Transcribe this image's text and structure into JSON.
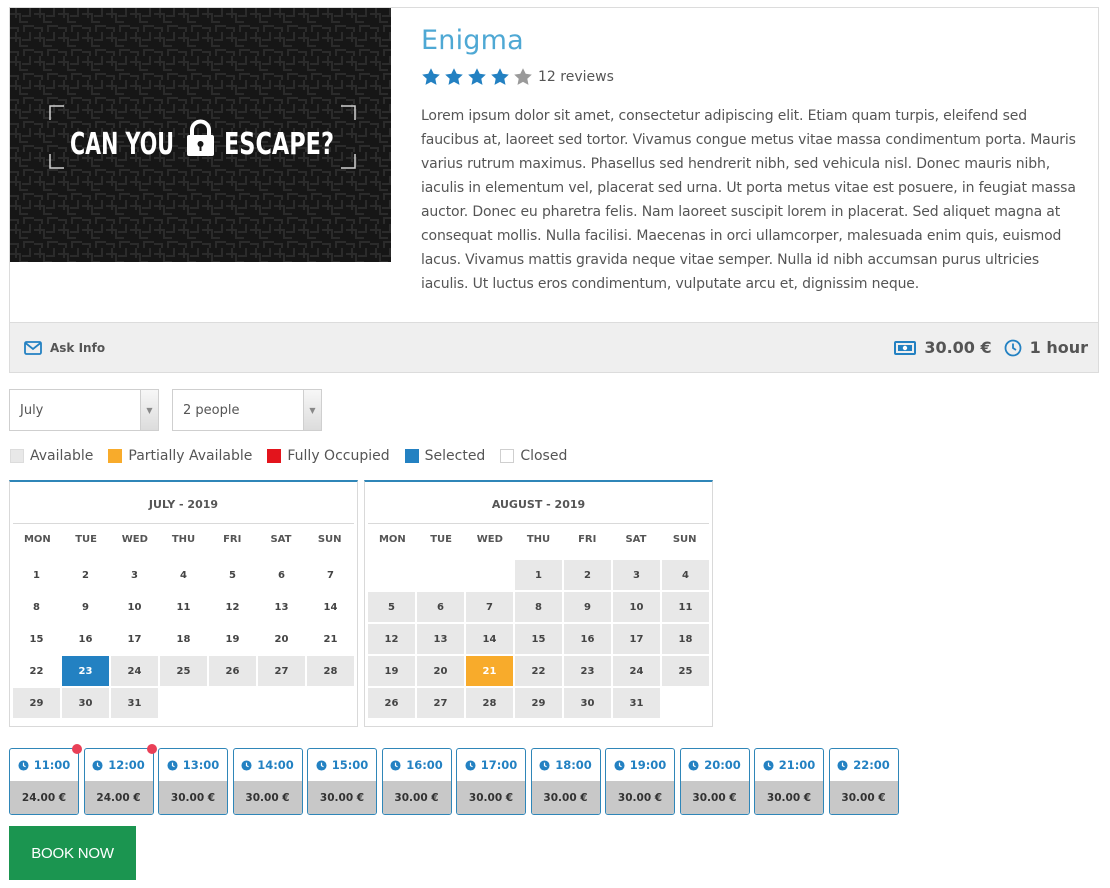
{
  "product": {
    "title": "Enigma",
    "rating": {
      "stars": 4,
      "max": 5,
      "reviews_label": "12 reviews"
    },
    "hero_image": {
      "text_left": "CAN YOU",
      "text_right": "ESCAPE?",
      "icon": "lock-icon"
    },
    "description": "Lorem ipsum dolor sit amet, consectetur adipiscing elit. Etiam quam turpis, eleifend sed faucibus at, laoreet sed tortor. Vivamus congue metus vitae massa condimentum porta. Mauris varius rutrum maximus. Phasellus sed hendrerit nibh, sed vehicula nisl. Donec mauris nibh, iaculis in elementum vel, placerat sed urna. Ut porta metus vitae est posuere, in feugiat massa auctor. Donec eu pharetra felis. Nam laoreet suscipit lorem in placerat. Sed aliquet magna at consequat mollis. Nulla facilisi. Maecenas in orci ullamcorper, malesuada enim quis, euismod lacus. Vivamus mattis gravida neque vitae semper. Nulla id nibh accumsan purus ultricies iaculis. Ut luctus eros condimentum, vulputate arcu et, dignissim neque.",
    "footer": {
      "ask_info": "Ask Info",
      "price": "30.00 €",
      "duration": "1 hour"
    }
  },
  "selectors": {
    "month": "July",
    "people": "2 people"
  },
  "legend": [
    {
      "label": "Available",
      "color": "#e8e8e8"
    },
    {
      "label": "Partially Available",
      "color": "#f8ab2b"
    },
    {
      "label": "Fully Occupied",
      "color": "#e3141c"
    },
    {
      "label": "Selected",
      "color": "#2381c2"
    },
    {
      "label": "Closed",
      "color": "#ffffff"
    }
  ],
  "weekdays": [
    "MON",
    "TUE",
    "WED",
    "THU",
    "FRI",
    "SAT",
    "SUN"
  ],
  "calendars": [
    {
      "title": "JULY - 2019",
      "offset": 0,
      "days": [
        {
          "d": "1",
          "s": "closed"
        },
        {
          "d": "2",
          "s": "closed"
        },
        {
          "d": "3",
          "s": "closed"
        },
        {
          "d": "4",
          "s": "closed"
        },
        {
          "d": "5",
          "s": "closed"
        },
        {
          "d": "6",
          "s": "closed"
        },
        {
          "d": "7",
          "s": "closed"
        },
        {
          "d": "8",
          "s": "closed"
        },
        {
          "d": "9",
          "s": "closed"
        },
        {
          "d": "10",
          "s": "closed"
        },
        {
          "d": "11",
          "s": "closed"
        },
        {
          "d": "12",
          "s": "closed"
        },
        {
          "d": "13",
          "s": "closed"
        },
        {
          "d": "14",
          "s": "closed"
        },
        {
          "d": "15",
          "s": "closed"
        },
        {
          "d": "16",
          "s": "closed"
        },
        {
          "d": "17",
          "s": "closed"
        },
        {
          "d": "18",
          "s": "closed"
        },
        {
          "d": "19",
          "s": "closed"
        },
        {
          "d": "20",
          "s": "closed"
        },
        {
          "d": "21",
          "s": "closed"
        },
        {
          "d": "22",
          "s": "closed"
        },
        {
          "d": "23",
          "s": "selected"
        },
        {
          "d": "24",
          "s": "available"
        },
        {
          "d": "25",
          "s": "available"
        },
        {
          "d": "26",
          "s": "available"
        },
        {
          "d": "27",
          "s": "available"
        },
        {
          "d": "28",
          "s": "available"
        },
        {
          "d": "29",
          "s": "available"
        },
        {
          "d": "30",
          "s": "available"
        },
        {
          "d": "31",
          "s": "available"
        }
      ]
    },
    {
      "title": "AUGUST - 2019",
      "offset": 3,
      "days": [
        {
          "d": "1",
          "s": "available"
        },
        {
          "d": "2",
          "s": "available"
        },
        {
          "d": "3",
          "s": "available"
        },
        {
          "d": "4",
          "s": "available"
        },
        {
          "d": "5",
          "s": "available"
        },
        {
          "d": "6",
          "s": "available"
        },
        {
          "d": "7",
          "s": "available"
        },
        {
          "d": "8",
          "s": "available"
        },
        {
          "d": "9",
          "s": "available"
        },
        {
          "d": "10",
          "s": "available"
        },
        {
          "d": "11",
          "s": "available"
        },
        {
          "d": "12",
          "s": "available"
        },
        {
          "d": "13",
          "s": "available"
        },
        {
          "d": "14",
          "s": "available"
        },
        {
          "d": "15",
          "s": "available"
        },
        {
          "d": "16",
          "s": "available"
        },
        {
          "d": "17",
          "s": "available"
        },
        {
          "d": "18",
          "s": "available"
        },
        {
          "d": "19",
          "s": "available"
        },
        {
          "d": "20",
          "s": "available"
        },
        {
          "d": "21",
          "s": "partial"
        },
        {
          "d": "22",
          "s": "available"
        },
        {
          "d": "23",
          "s": "available"
        },
        {
          "d": "24",
          "s": "available"
        },
        {
          "d": "25",
          "s": "available"
        },
        {
          "d": "26",
          "s": "available"
        },
        {
          "d": "27",
          "s": "available"
        },
        {
          "d": "28",
          "s": "available"
        },
        {
          "d": "29",
          "s": "available"
        },
        {
          "d": "30",
          "s": "available"
        },
        {
          "d": "31",
          "s": "available"
        }
      ]
    }
  ],
  "time_slots": [
    {
      "time": "11:00",
      "price": "24.00 €",
      "badge": true
    },
    {
      "time": "12:00",
      "price": "24.00 €",
      "badge": true
    },
    {
      "time": "13:00",
      "price": "30.00 €",
      "badge": false
    },
    {
      "time": "14:00",
      "price": "30.00 €",
      "badge": false
    },
    {
      "time": "15:00",
      "price": "30.00 €",
      "badge": false
    },
    {
      "time": "16:00",
      "price": "30.00 €",
      "badge": false
    },
    {
      "time": "17:00",
      "price": "30.00 €",
      "badge": false
    },
    {
      "time": "18:00",
      "price": "30.00 €",
      "badge": false
    },
    {
      "time": "19:00",
      "price": "30.00 €",
      "badge": false
    },
    {
      "time": "20:00",
      "price": "30.00 €",
      "badge": false
    },
    {
      "time": "21:00",
      "price": "30.00 €",
      "badge": false
    },
    {
      "time": "22:00",
      "price": "30.00 €",
      "badge": false
    }
  ],
  "book_now": "BOOK NOW"
}
